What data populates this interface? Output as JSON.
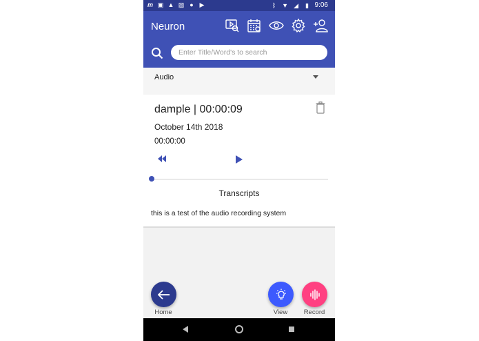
{
  "status_bar": {
    "time": "9:06"
  },
  "app_bar": {
    "title": "Neuron",
    "actions": [
      "video-search-icon",
      "calendar-icon",
      "eye-icon",
      "gear-icon",
      "add-person-icon"
    ]
  },
  "search": {
    "placeholder": "Enter Title/Word's to search",
    "value": ""
  },
  "filter": {
    "selected": "Audio"
  },
  "recording": {
    "title": "dample | 00:00:09",
    "date": "October 14th 2018",
    "current_time": "00:00:00",
    "progress": 0
  },
  "transcripts": {
    "heading": "Transcripts",
    "text": "this is a test of the audio recording system"
  },
  "fabs": {
    "home_label": "Home",
    "view_label": "View",
    "record_label": "Record"
  },
  "colors": {
    "primary": "#3f51b5",
    "primary_dark": "#2c3a8e",
    "accent_view": "#3d5afe",
    "accent_record": "#ff4081"
  }
}
